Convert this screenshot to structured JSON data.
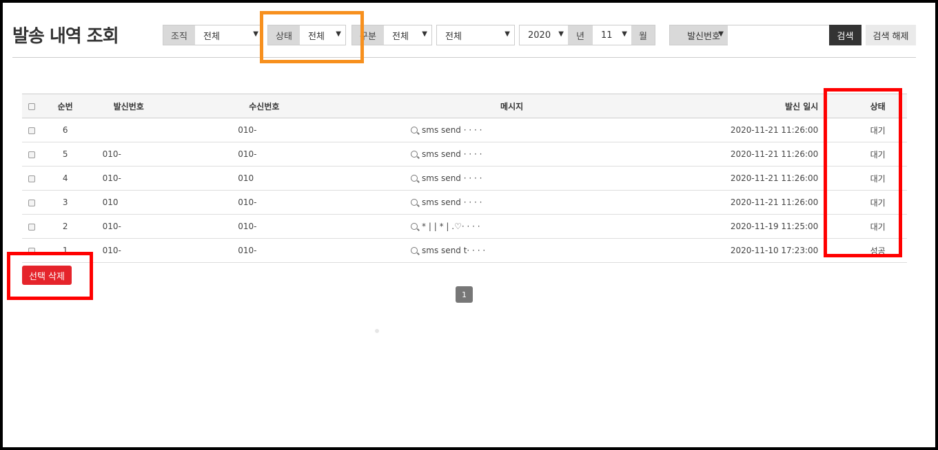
{
  "page": {
    "title": "발송 내역 조회"
  },
  "filters": {
    "org_label": "조직",
    "org_value": "전체",
    "status_label": "상태",
    "status_value": "전체",
    "type_label": "구분",
    "type_value": "전체",
    "type2_value": "전체",
    "year_value": "2020",
    "year_label": "년",
    "month_value": "11",
    "month_label": "월",
    "sender_label": "발신번호",
    "search_placeholder": "",
    "search_button": "검색",
    "clear_button": "검색 해제"
  },
  "table": {
    "headers": [
      "순번",
      "발신번호",
      "수신번호",
      "메시지",
      "발신 일시",
      "상태"
    ],
    "rows": [
      {
        "no": "6",
        "from": "",
        "to": "010-",
        "msg": "sms send · · · ·",
        "date": "2020-11-21 11:26:00",
        "status": "대기"
      },
      {
        "no": "5",
        "from": "010-",
        "to": "010-",
        "msg": "sms send · · · ·",
        "date": "2020-11-21 11:26:00",
        "status": "대기"
      },
      {
        "no": "4",
        "from": "010-",
        "to": "010",
        "msg": "sms send · · · ·",
        "date": "2020-11-21 11:26:00",
        "status": "대기"
      },
      {
        "no": "3",
        "from": "010",
        "to": "010-",
        "msg": "sms send · · · ·",
        "date": "2020-11-21 11:26:00",
        "status": "대기"
      },
      {
        "no": "2",
        "from": "010-",
        "to": "010-",
        "msg": "* | | * | .♡· · · ·",
        "date": "2020-11-19 11:25:00",
        "status": "대기"
      },
      {
        "no": "1",
        "from": "010-",
        "to": "010-",
        "msg": "sms send t· · · ·",
        "date": "2020-11-10 17:23:00",
        "status": "성공"
      }
    ]
  },
  "actions": {
    "delete_selected": "선택 삭제"
  },
  "pagination": {
    "current": "1"
  },
  "colors": {
    "highlight_orange": "#f7901e",
    "highlight_red": "#ff0000",
    "delete_button": "#e5242b",
    "status_wait": "#6b9bc8"
  }
}
